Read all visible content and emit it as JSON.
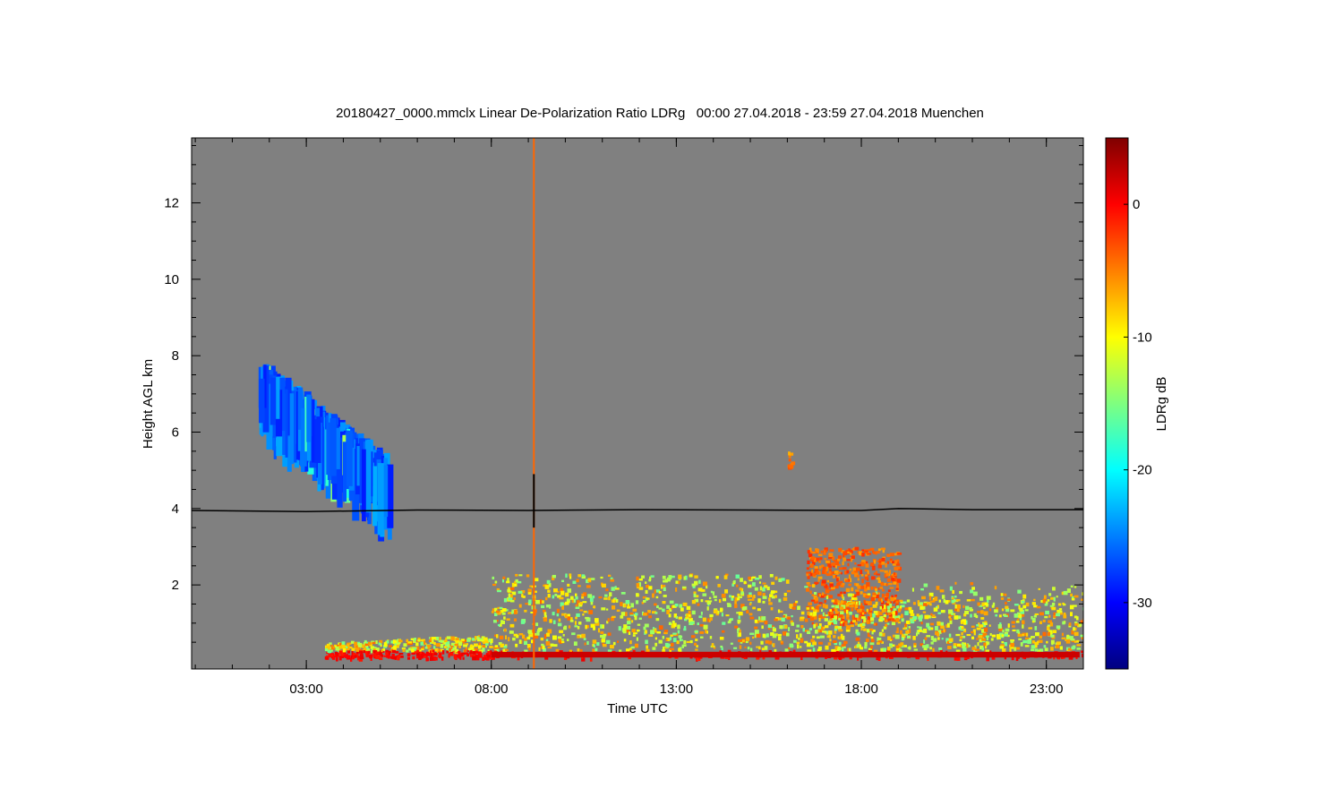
{
  "chart_data": {
    "type": "heatmap",
    "title": "20180427_0000.mmclx Linear De-Polarization Ratio LDRg   00:00 27.04.2018 - 23:59 27.04.2018 Muenchen",
    "xlabel": "Time UTC",
    "ylabel": "Height AGL km",
    "x_unit": "hours UTC",
    "xlim": [
      -0.1,
      24.0
    ],
    "ylim": [
      -0.2,
      13.7
    ],
    "x_ticks": [
      {
        "value": 3,
        "label": "03:00"
      },
      {
        "value": 8,
        "label": "08:00"
      },
      {
        "value": 13,
        "label": "13:00"
      },
      {
        "value": 18,
        "label": "18:00"
      },
      {
        "value": 23,
        "label": "23:00"
      }
    ],
    "y_ticks": [
      {
        "value": 2,
        "label": "2"
      },
      {
        "value": 4,
        "label": "4"
      },
      {
        "value": 6,
        "label": "6"
      },
      {
        "value": 8,
        "label": "8"
      },
      {
        "value": 10,
        "label": "10"
      },
      {
        "value": 12,
        "label": "12"
      }
    ],
    "background_color": "#808080",
    "grid": false,
    "colorbar": {
      "label": "LDRg dB",
      "range": [
        -35,
        5
      ],
      "ticks": [
        {
          "value": 0,
          "label": "0"
        },
        {
          "value": -10,
          "label": "-10"
        },
        {
          "value": -20,
          "label": "-20"
        },
        {
          "value": -30,
          "label": "-30"
        }
      ],
      "colormap": [
        "#00007f",
        "#0000ff",
        "#007fff",
        "#00ffff",
        "#7fff7f",
        "#ffff00",
        "#ff7f00",
        "#ff0000",
        "#7f0000"
      ]
    },
    "line_series": {
      "color": "#000000",
      "points": [
        [
          -0.1,
          3.95
        ],
        [
          3.0,
          3.92
        ],
        [
          6.0,
          3.96
        ],
        [
          9.0,
          3.95
        ],
        [
          12.0,
          3.97
        ],
        [
          15.0,
          3.96
        ],
        [
          18.0,
          3.95
        ],
        [
          19.0,
          4.0
        ],
        [
          21.0,
          3.97
        ],
        [
          24.0,
          3.97
        ]
      ]
    },
    "vertical_spike": {
      "time": 9.15,
      "ldr_db": -4
    },
    "features": [
      {
        "region": "ice cloud",
        "time_range": [
          1.7,
          5.2
        ],
        "height_range": [
          4.3,
          7.7
        ],
        "ldr_db": -26
      },
      {
        "region": "melting layer",
        "time_range": [
          16.5,
          19.0
        ],
        "height_range": [
          1.0,
          3.0
        ],
        "ldr_db": -4
      },
      {
        "region": "boundary layer echoes",
        "time_range": [
          3.5,
          24.0
        ],
        "height_range": [
          0.1,
          2.3
        ],
        "ldr_db": -10
      },
      {
        "region": "isolated echo",
        "time_range": [
          16.0,
          16.1
        ],
        "height_range": [
          5.1,
          5.5
        ],
        "ldr_db": -5
      }
    ]
  }
}
